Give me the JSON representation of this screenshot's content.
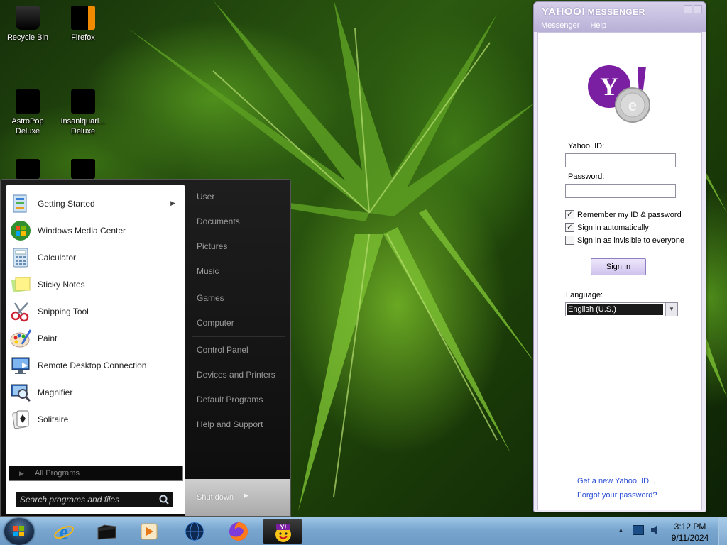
{
  "desktop": {
    "icons": [
      {
        "label": "Recycle Bin"
      },
      {
        "label": "Firefox"
      },
      {
        "label": "AstroPop",
        "label2": "Deluxe"
      },
      {
        "label": "Insaniquari...",
        "label2": "Deluxe"
      }
    ]
  },
  "start_menu": {
    "programs": [
      {
        "label": "Getting Started",
        "icon": "getting-started-icon",
        "has_submenu": true
      },
      {
        "label": "Windows Media Center",
        "icon": "media-center-icon"
      },
      {
        "label": "Calculator",
        "icon": "calculator-icon"
      },
      {
        "label": "Sticky Notes",
        "icon": "sticky-notes-icon"
      },
      {
        "label": "Snipping Tool",
        "icon": "scissors-icon"
      },
      {
        "label": "Paint",
        "icon": "paint-palette-icon"
      },
      {
        "label": "Remote Desktop Connection",
        "icon": "remote-desktop-icon"
      },
      {
        "label": "Magnifier",
        "icon": "magnifier-icon"
      },
      {
        "label": "Solitaire",
        "icon": "playing-card-icon"
      }
    ],
    "all_programs": "All Programs",
    "search_placeholder": "Search programs and files",
    "places": [
      {
        "label": "User"
      },
      {
        "label": "Documents"
      },
      {
        "label": "Pictures"
      },
      {
        "label": "Music"
      },
      {
        "label": "Games"
      },
      {
        "label": "Computer"
      },
      {
        "label": "Control Panel"
      },
      {
        "label": "Devices and Printers"
      },
      {
        "label": "Default Programs"
      },
      {
        "label": "Help and Support"
      }
    ],
    "shutdown": "Shut down"
  },
  "messenger": {
    "brand": "YAHOO!",
    "brand_sub": "MESSENGER",
    "menu": [
      "Messenger",
      "Help"
    ],
    "yahoo_id_label": "Yahoo! ID:",
    "yahoo_id_value": "",
    "password_label": "Password:",
    "password_value": "",
    "checkboxes": [
      {
        "label": "Remember my ID & password",
        "checked": true
      },
      {
        "label": "Sign in automatically",
        "checked": true
      },
      {
        "label": "Sign in as invisible to everyone",
        "checked": false
      }
    ],
    "sign_in": "Sign In",
    "language_label": "Language:",
    "language_value": "English (U.S.)",
    "link_new_id": "Get a new Yahoo! ID...",
    "link_forgot": "Forgot your password?",
    "accent": "#7b1fa2"
  },
  "taskbar": {
    "apps": [
      "internet-explorer-icon",
      "explorer-folder-icon",
      "media-player-icon",
      "globe-icon",
      "firefox-icon",
      "yahoo-messenger-icon"
    ],
    "time": "3:12 PM",
    "date": "9/11/2024"
  }
}
